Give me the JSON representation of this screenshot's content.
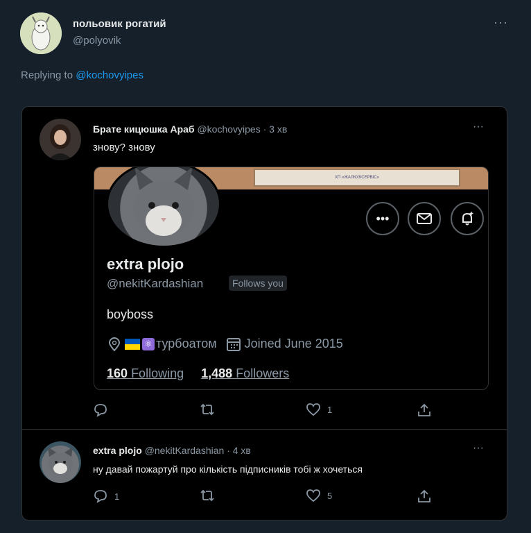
{
  "outer_tweet": {
    "author_name": "польовик рогатий",
    "author_handle": "@polyovik",
    "more_label": "···",
    "replying_prefix": "Replying to",
    "replying_handle": "@kochovyipes"
  },
  "quoted_tweet": {
    "author_name": "Брате кицюшка Араб",
    "author_handle": "@kochovyipes",
    "time": "· 3 хв",
    "more_label": "···",
    "text": "знову? знову",
    "actions": {
      "reply_count": "",
      "retweet_count": "",
      "like_count": "1",
      "icons": [
        "reply-icon",
        "retweet-icon",
        "like-icon",
        "share-icon"
      ]
    }
  },
  "profile_screenshot": {
    "banner_sign_text": "ХП «ЖАЛЮЗІСЕРВІС»",
    "display_name": "extra plojo",
    "handle": "@nekitKardashian",
    "follows_you": "Follows you",
    "bio": "boyboss",
    "location": "турбоатом",
    "joined": "Joined June 2015",
    "following_count": "160",
    "following_label": "Following",
    "followers_count": "1,488",
    "followers_label": "Followers",
    "buttons": [
      "more-icon",
      "mail-icon",
      "bell-icon"
    ]
  },
  "reply_tweet": {
    "author_name": "extra plojo",
    "author_handle": "@nekitKardashian",
    "time": "· 4 хв",
    "more_label": "···",
    "text": "ну давай пожартуй про кількість підписників тобі ж хочеться",
    "actions": {
      "reply_count": "1",
      "retweet_count": "",
      "like_count": "5",
      "icons": [
        "reply-icon",
        "retweet-icon",
        "like-icon",
        "share-icon"
      ]
    }
  },
  "colors": {
    "background": "#15202b",
    "box_background": "#000000",
    "link": "#1d9bf0",
    "muted": "#8b98a5",
    "text": "#e7e9ea"
  }
}
